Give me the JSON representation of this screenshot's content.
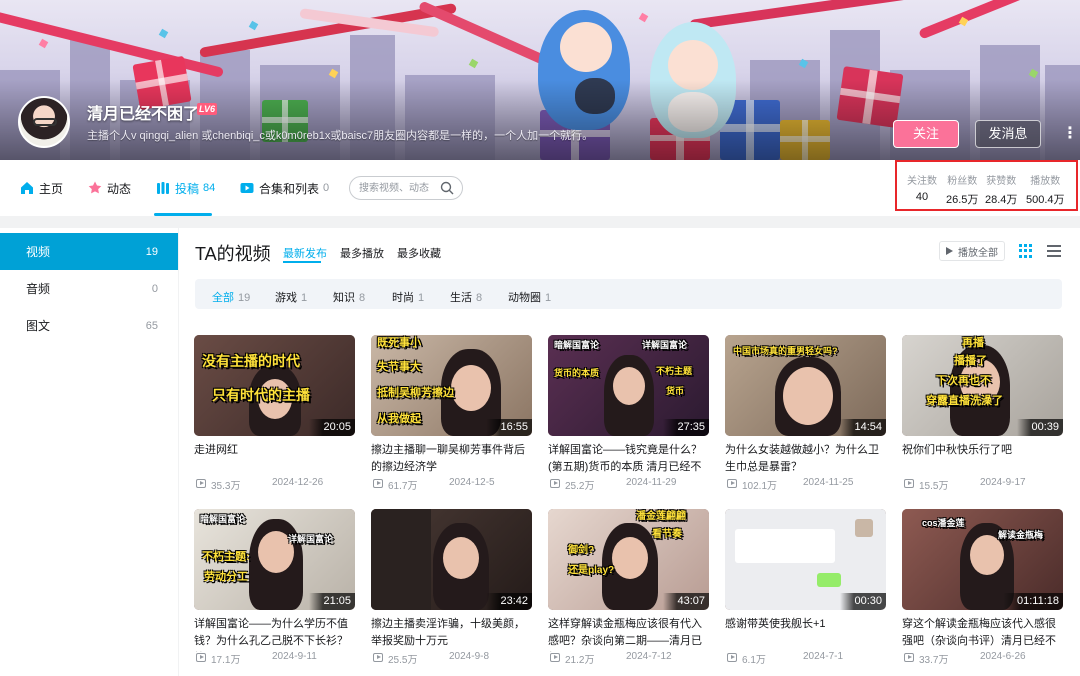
{
  "user": {
    "name": "清月已经不困了",
    "level": "LV6",
    "sign": "主播个人v qingqi_alien 或chenbiqi_c或k0m0reb1x或baisc7朋友圈内容都是一样的，一个人加一个就行。",
    "follow_label": "关注",
    "message_label": "发消息",
    "more_label": "⋮"
  },
  "colors": {
    "accent": "#00aeec",
    "follow": "#fb7299",
    "sidebar_active": "#00a1d6",
    "highlight_box": "#e8262a"
  },
  "nav": {
    "tabs": [
      {
        "label": "主页",
        "count": "",
        "icon": "home-icon"
      },
      {
        "label": "动态",
        "count": "",
        "icon": "dynamic-icon"
      },
      {
        "label": "投稿",
        "count": "84",
        "icon": "upload-icon",
        "active": true
      },
      {
        "label": "合集和列表",
        "count": "0",
        "icon": "collection-icon"
      }
    ],
    "search_placeholder": "搜索视频、动态"
  },
  "stats": [
    {
      "label": "关注数",
      "value": "40"
    },
    {
      "label": "粉丝数",
      "value": "26.5万"
    },
    {
      "label": "获赞数",
      "value": "28.4万"
    },
    {
      "label": "播放数",
      "value": "500.4万"
    }
  ],
  "sidebar": {
    "items": [
      {
        "label": "视频",
        "count": "19",
        "active": true
      },
      {
        "label": "音频",
        "count": "0"
      },
      {
        "label": "图文",
        "count": "65"
      }
    ]
  },
  "main": {
    "title": "TA的视频",
    "sort_tabs": [
      "最新发布",
      "最多播放",
      "最多收藏"
    ],
    "play_all": "播放全部",
    "filters": [
      {
        "label": "全部",
        "count": "19"
      },
      {
        "label": "游戏",
        "count": "1"
      },
      {
        "label": "知识",
        "count": "8"
      },
      {
        "label": "时尚",
        "count": "1"
      },
      {
        "label": "生活",
        "count": "8"
      },
      {
        "label": "动物圈",
        "count": "1"
      }
    ]
  },
  "videos": [
    {
      "title": "走进网红",
      "duration": "20:05",
      "plays": "35.3万",
      "date": "2024-12-26",
      "caption": [
        "没有主播的时代",
        "只有时代的主播"
      ]
    },
    {
      "title": "擦边主播聊一聊吴柳芳事件背后的擦边经济学",
      "duration": "16:55",
      "plays": "61.7万",
      "date": "2024-12-5",
      "caption": [
        "既死事小",
        "失节事大",
        "抵制吴柳芳擦边",
        "从我做起"
      ]
    },
    {
      "title": "详解国富论——钱究竟是什么？(第五期)货币的本质 清月已经不困了",
      "duration": "27:35",
      "plays": "25.2万",
      "date": "2024-11-29",
      "caption": [
        "暗解国富论",
        "详解国富论",
        "货币的本质",
        "不朽主题",
        "货币"
      ]
    },
    {
      "title": "为什么女装越做越小？为什么卫生巾总是暴雷？",
      "duration": "14:54",
      "plays": "102.1万",
      "date": "2024-11-25",
      "caption": [
        "中国市场真的重男轻女吗?"
      ]
    },
    {
      "title": "祝你们中秋快乐行了吧",
      "duration": "00:39",
      "plays": "15.5万",
      "date": "2024-9-17",
      "caption": [
        "再播",
        "播播了",
        "下次再也不",
        "穿露直播洗澡了"
      ]
    },
    {
      "title": "详解国富论——为什么学历不值钱？为什么孔乙己脱不下长衫？第",
      "duration": "21:05",
      "plays": "17.1万",
      "date": "2024-9-11",
      "caption": [
        "暗解国富论",
        "详解国富论",
        "不朽主题:",
        "劳动分工"
      ]
    },
    {
      "title": "擦边主播卖淫诈骗，十级美颜，举报奖励十万元",
      "duration": "23:42",
      "plays": "25.5万",
      "date": "2024-9-8",
      "caption": []
    },
    {
      "title": "这样穿解读金瓶梅应该很有代入感吧？杂谈向第二期——清月已经不",
      "duration": "43:07",
      "plays": "21.2万",
      "date": "2024-7-12",
      "caption": [
        "潘金莲翩翩",
        "看节奏",
        "御剑?",
        "还是play?"
      ]
    },
    {
      "title": "感谢带英使我舰长+1",
      "duration": "00:30",
      "plays": "6.1万",
      "date": "2024-7-1",
      "caption": []
    },
    {
      "title": "穿这个解读金瓶梅应该代入感很强吧（杂谈向书评）清月已经不困了",
      "duration": "01:11:18",
      "plays": "33.7万",
      "date": "2024-6-26",
      "caption": [
        "cos潘金莲",
        "解读金瓶梅"
      ]
    }
  ]
}
